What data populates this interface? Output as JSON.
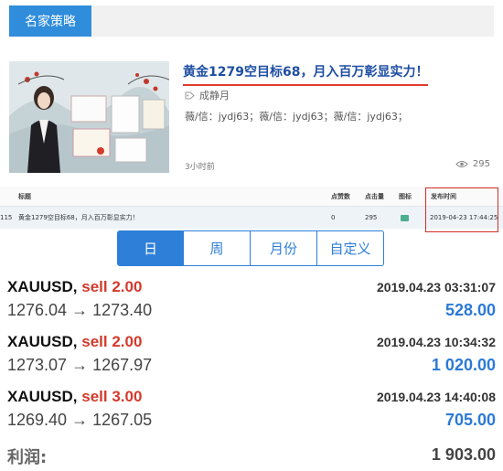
{
  "header": {
    "tab_label": "名家策略"
  },
  "article": {
    "headline": "黄金1279空目标68，月入百万彰显实力！",
    "author": "成静月",
    "contact": "薇/信：jydj63；薇/信：jydj63；薇/信：jydj63；",
    "time_ago": "3小时前",
    "views": "295"
  },
  "table": {
    "headers": {
      "title": "标题",
      "likes": "点赞数",
      "clicks": "点击量",
      "icon": "图标",
      "publish_time": "发布时间"
    },
    "row": {
      "index": "115",
      "title": "黄金1279空目标68，月入百万彰显实力！",
      "likes": "0",
      "clicks": "295",
      "publish_time": "2019-04-23 17:44:25"
    }
  },
  "segments": [
    "日",
    "周",
    "月份",
    "自定义"
  ],
  "trades": [
    {
      "symbol": "XAUUSD,",
      "side": "sell 2.00",
      "datetime": "2019.04.23 03:31:07",
      "prices": "1276.04 → 1273.40",
      "profit": "528.00"
    },
    {
      "symbol": "XAUUSD,",
      "side": "sell 2.00",
      "datetime": "2019.04.23 10:34:32",
      "prices": "1273.07 → 1267.97",
      "profit": "1 020.00"
    },
    {
      "symbol": "XAUUSD,",
      "side": "sell 3.00",
      "datetime": "2019.04.23 14:40:08",
      "prices": "1269.40 → 1267.05",
      "profit": "705.00"
    }
  ],
  "summary": {
    "label": "利润:",
    "total": "1 903.00"
  },
  "colors": {
    "accent": "#2e7fd8",
    "sell": "#d33a2c",
    "highlight": "#e23b2e"
  }
}
